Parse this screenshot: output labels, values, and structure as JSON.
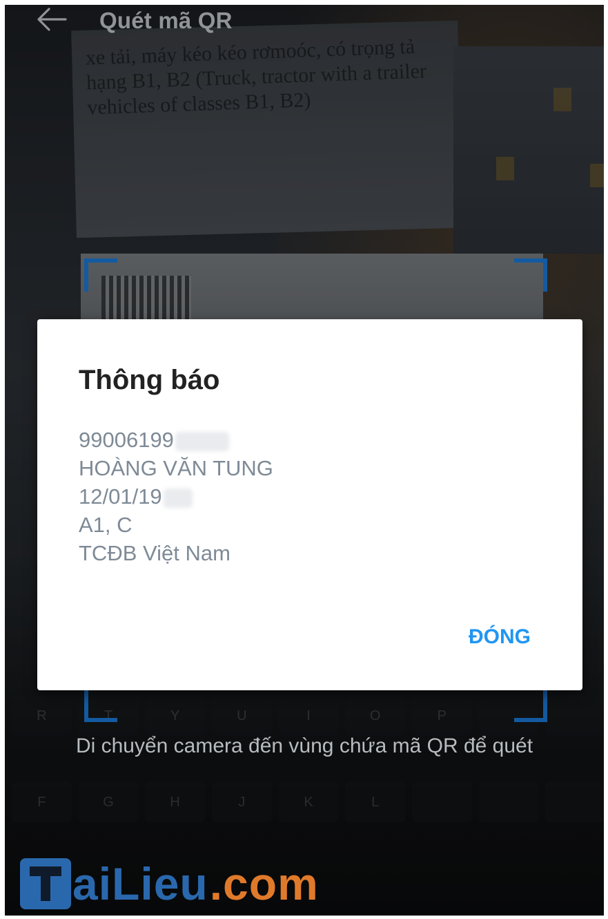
{
  "header": {
    "title": "Quét mã QR",
    "back_icon": "arrow-left-icon"
  },
  "background": {
    "paper_text": "xe tải, máy kéo kéo rơmoóc, có trọng tả hạng B1, B2 (Truck, tractor with a trailer vehicles of classes B1, B2)"
  },
  "dialog": {
    "title": "Thông báo",
    "lines": [
      "99006199",
      "HOÀNG VĂN TUNG",
      "12/01/19",
      "A1, C",
      "TCĐB Việt Nam"
    ],
    "close_label": "ĐÓNG"
  },
  "hint": "Di chuyển camera đến vùng chứa mã QR để quét",
  "watermark": {
    "part1": "aiLieu",
    "part2": ".com"
  },
  "colors": {
    "accent": "#2196f3",
    "frame": "#1d7de0",
    "watermark_blue": "#2a68ad",
    "watermark_orange": "#e07a2b"
  }
}
